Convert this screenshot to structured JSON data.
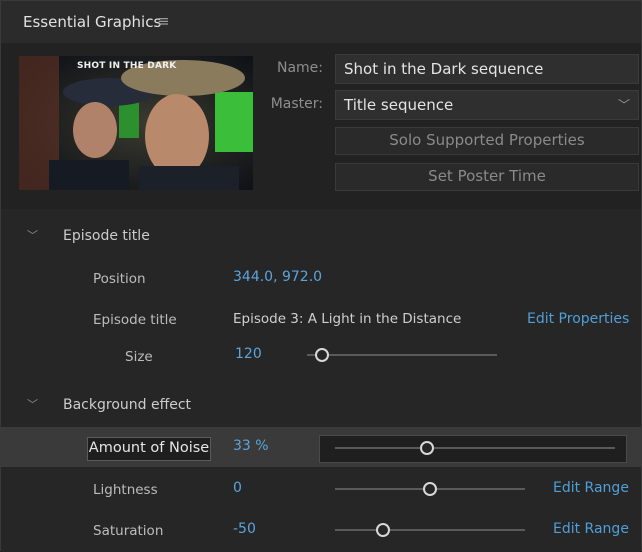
{
  "panel": {
    "title": "Essential Graphics",
    "menu_icon": "hamburger-menu-icon"
  },
  "thumbnail": {
    "caption": "SHOT IN THE DARK"
  },
  "fields": {
    "name_label": "Name:",
    "name_value": "Shot in the Dark sequence",
    "master_label": "Master:",
    "master_value": "Title sequence"
  },
  "buttons": {
    "solo": "Solo Supported Properties",
    "poster": "Set Poster Time"
  },
  "episode": {
    "section_title": "Episode title",
    "position_label": "Position",
    "position_value": "344.0, 972.0",
    "title_label": "Episode title",
    "title_value": "Episode 3: A Light in the Distance",
    "edit_properties": "Edit Properties",
    "size_label": "Size",
    "size_value": "120",
    "size_slider_fraction": 0.08
  },
  "background": {
    "section_title": "Background effect",
    "noise_label": "Amount of Noise",
    "noise_value": "33 %",
    "noise_fraction": 0.33,
    "lightness_label": "Lightness",
    "lightness_value": "0",
    "lightness_fraction": 0.5,
    "saturation_label": "Saturation",
    "saturation_value": "-50",
    "saturation_fraction": 0.25,
    "edit_range": "Edit Range"
  },
  "colors": {
    "accent": "#5aa5dc",
    "link": "#4f9fd8",
    "background": "#262626"
  }
}
